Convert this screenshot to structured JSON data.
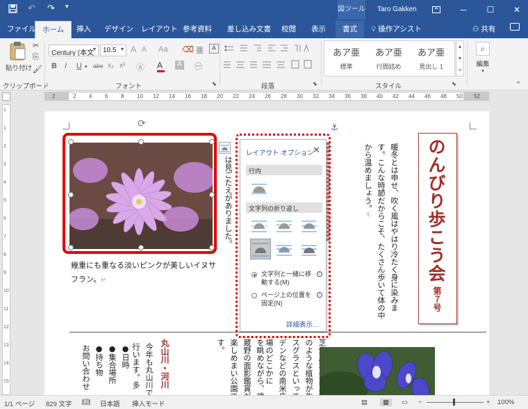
{
  "titlebar": {
    "tool_context": "図ツール",
    "user": "Taro Gakken",
    "save_icon": "save-icon",
    "undo_icon": "undo-icon",
    "redo_icon": "redo-icon",
    "customize_icon": "customize-qat-icon"
  },
  "tabs": {
    "items": [
      "ファイル",
      "ホーム",
      "挿入",
      "デザイン",
      "レイアウト",
      "参考資料",
      "差し込み文書",
      "校閲",
      "表示",
      "書式"
    ],
    "active": "ホーム",
    "assist": "操作アシスト",
    "share": "共有"
  },
  "ribbon": {
    "clipboard": {
      "paste": "貼り付け",
      "group": "クリップボード"
    },
    "font": {
      "name": "Century (本文",
      "size": "10.5",
      "grow": "A",
      "shrink": "A",
      "case": "Aa",
      "bold": "B",
      "italic": "I",
      "underline": "U",
      "strike": "abc",
      "sub": "x₂",
      "sup": "x²",
      "color_a": "A",
      "char_shade": "A",
      "group": "フォント"
    },
    "paragraph": {
      "group": "段落"
    },
    "styles": {
      "items": [
        {
          "sample": "あア亜",
          "name": "標準"
        },
        {
          "sample": "あア亜",
          "name": "行間詰め"
        },
        {
          "sample": "あア亜",
          "name": "見出し 1"
        }
      ],
      "group": "スタイル"
    },
    "editing": {
      "label": "編集"
    }
  },
  "ruler": {
    "left_marker": "2",
    "right_marker": "52",
    "ticks": [
      "2",
      "4",
      "6",
      "8",
      "10",
      "12",
      "14",
      "16",
      "18",
      "20",
      "22",
      "24",
      "26",
      "28",
      "30",
      "32",
      "34",
      "36",
      "38",
      "40",
      "42",
      "44",
      "46",
      "48",
      "50"
    ]
  },
  "vruler": {
    "ticks": [
      "1",
      "1",
      "2",
      "3",
      "4",
      "5",
      "6",
      "7",
      "8",
      "9",
      "10",
      "11",
      "12",
      "13",
      "14",
      "15"
    ]
  },
  "document": {
    "title": "のんびり歩こう会",
    "issue": "第７号",
    "intro": "暖冬とは申せ、吹く風はやはり冷たく身に染みます。こんな時節だからこそ、たくさん歩いて体の中から温めましょう。",
    "caption": "幾重にも重なる淡いピンクがの美しいイヌサフラン。",
    "caption_display": "幾重にも重なる淡いピンクが美しいイヌサフラン。",
    "fragment_red": "丸山川・河川",
    "fragment_behind": "は見ごたえがありました。",
    "col_a": "芝生広場の真ん中のような植物が生スグラスといってデンなどの南米広場のどこかに",
    "col_b": "を眺めながら、武蔵野の面影鑑賞が楽しめまい公園です。",
    "col_c": "今年も丸山川で行います。多",
    "list": [
      "日時",
      "集合場所",
      "持ち物",
      "お問い合わせ"
    ]
  },
  "layout_popup": {
    "title": "レイアウト オプション",
    "inline_section": "行内",
    "wrap_section": "文字列の折り返し",
    "radio_move": "文字列と一緒に移動する(M)",
    "radio_fix": "ページ上の位置を固定(N)",
    "more": "詳細表示..."
  },
  "statusbar": {
    "page": "1/1 ページ",
    "words": "829 文字",
    "lang": "日本語",
    "mode": "挿入モード",
    "zoom": "100%"
  }
}
